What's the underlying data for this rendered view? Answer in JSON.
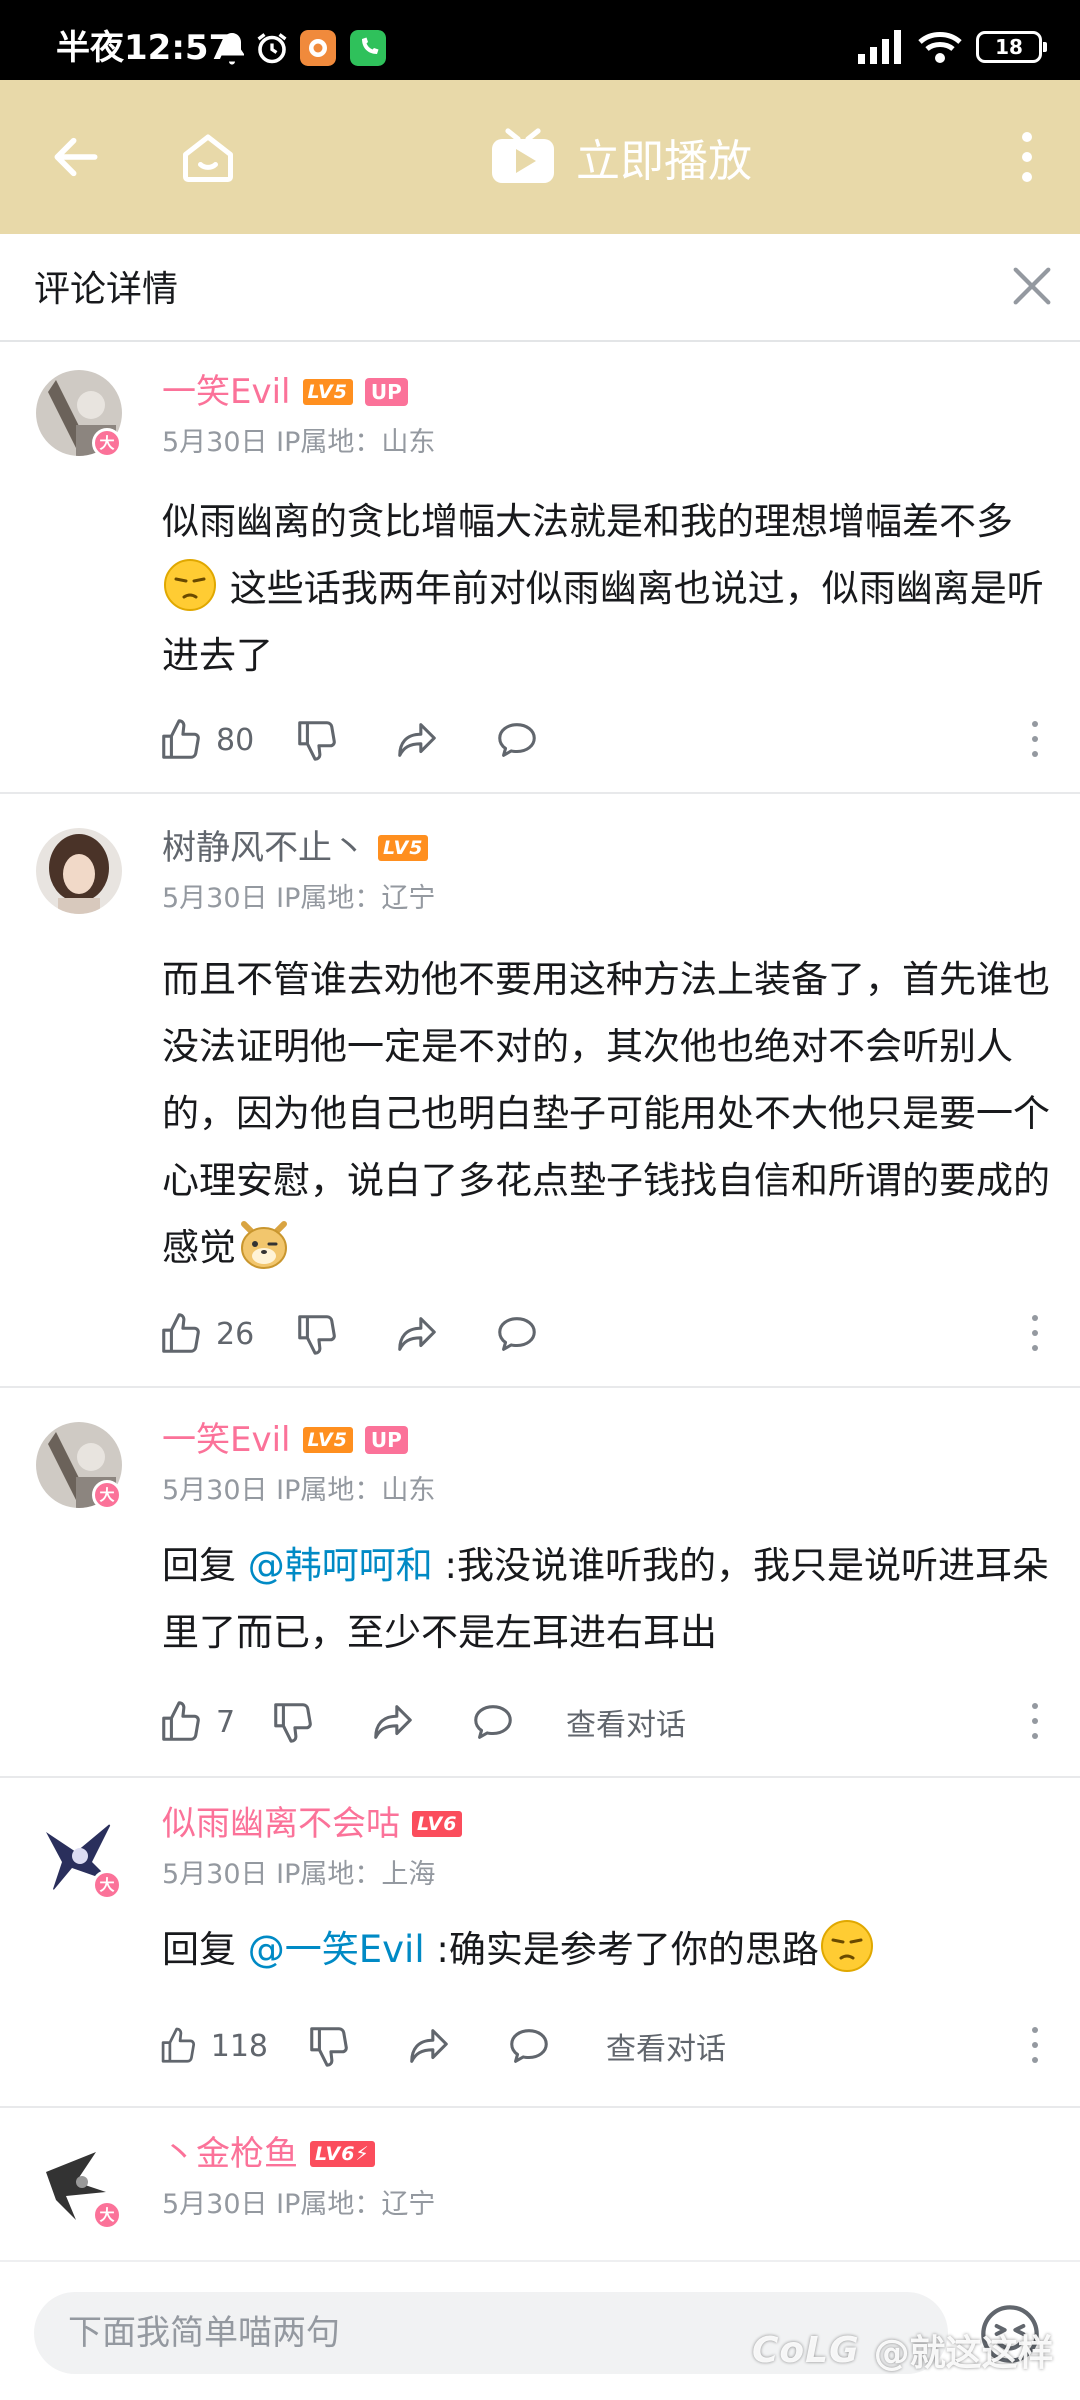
{
  "status_bar": {
    "time": "半夜12:57",
    "battery": "18"
  },
  "topbar": {
    "play_label": "立即播放"
  },
  "header": {
    "title": "评论详情"
  },
  "comments": [
    {
      "username": "一笑Evil",
      "level": "LV5",
      "up_tag": "UP",
      "badge": "大",
      "meta": "5月30日  IP属地：山东",
      "text_1": "似雨幽离的贪比增幅大法就是和我的理想增幅差不多",
      "text_2": "这些话我两年前对似雨幽离也说过，似雨幽离是听进去了",
      "likes": "80"
    },
    {
      "username": "树静风不止丶",
      "level": "LV5",
      "meta": "5月30日  IP属地：辽宁",
      "text_1": "而且不管谁去劝他不要用这种方法上装备了，首先谁也没法证明他一定是不对的，其次他也绝对不会听别人的，因为他自己也明白垫子可能用处不大他只是要一个心理安慰，说白了多花点垫子钱找自信和所谓的要成的感觉",
      "likes": "26"
    },
    {
      "username": "一笑Evil",
      "level": "LV5",
      "up_tag": "UP",
      "badge": "大",
      "meta": "5月30日  IP属地：山东",
      "reply_prefix": "回复 ",
      "mention": "@韩呵呵和",
      "text_1": " :我没说谁听我的，我只是说听进耳朵里了而已，至少不是左耳进右耳出",
      "likes": "7",
      "view_conversation": "查看对话"
    },
    {
      "username": "似雨幽离不会咕",
      "level": "LV6",
      "badge": "大",
      "meta": "5月30日  IP属地：上海",
      "reply_prefix": "回复 ",
      "mention": "@一笑Evil",
      "text_1": " :确实是参考了你的思路",
      "likes": "118",
      "view_conversation": "查看对话"
    },
    {
      "username": "丶金枪鱼",
      "level": "LV6⚡",
      "badge": "大",
      "meta": "5月30日  IP属地：辽宁"
    }
  ],
  "input": {
    "placeholder": "下面我简单喵两句"
  },
  "watermark": {
    "logo": "CoLG",
    "text": "@就这这样"
  },
  "colors": {
    "topbar": "#e8d9a9",
    "pink": "#fb7299",
    "mention": "#008ac5"
  }
}
